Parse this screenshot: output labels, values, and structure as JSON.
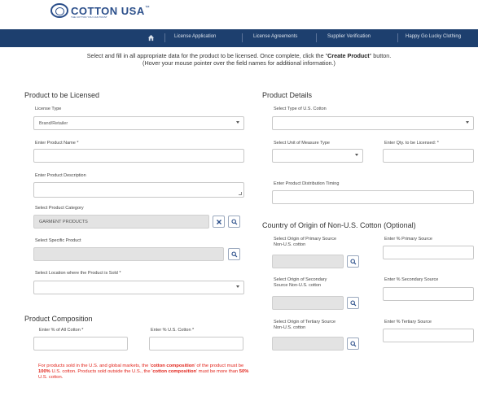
{
  "brand": {
    "logo_text": "COTTON USA",
    "tm": "™",
    "tagline": "THE COTTON YOU CAN TRUST"
  },
  "nav": {
    "items": [
      {
        "label": "License Application"
      },
      {
        "label": "License Agreements"
      },
      {
        "label": "Supplier Verification"
      },
      {
        "label": "Happy Go Lucky Clothing"
      }
    ]
  },
  "intro": {
    "line1_prefix": "Select and fill in all appropriate data for the product to be licensed.  Once complete, click the \"",
    "line1_bold": "Create Product",
    "line1_suffix": "\" button.",
    "line2": "(Hover your mouse pointer over the field names for additional information.)"
  },
  "left": {
    "title": "Product to be Licensed",
    "license_type": {
      "label": "License Type",
      "value": "Brand/Retailer"
    },
    "product_name": {
      "label": "Enter Product Name *",
      "value": ""
    },
    "product_description": {
      "label": "Enter Product Description",
      "value": ""
    },
    "product_category": {
      "label": "Select Product Category",
      "value": "GARMENT PRODUCTS"
    },
    "specific_product": {
      "label": "Select Specific Product",
      "value": ""
    },
    "location_sold": {
      "label": "Select Location where the Product is Sold *",
      "value": ""
    }
  },
  "composition": {
    "title": "Product Composition",
    "all_cotton": {
      "label": "Enter % of All Cotton *",
      "value": ""
    },
    "us_cotton": {
      "label": "Enter % U.S. Cotton *",
      "value": ""
    }
  },
  "warning": {
    "p1": "For products sold in the U.S. and global markets, the '",
    "b1": "cotton composition",
    "p2": "' of the product must be ",
    "b2": "100%",
    "p3": " U.S. cotton.  Products sold outside the U.S., the '",
    "b3": "cotton composition",
    "p4": "' must be more than ",
    "b4": "50%",
    "p5": " U.S. cotton."
  },
  "right": {
    "title": "Product Details",
    "type_us_cotton": {
      "label": "Select Type of U.S. Cotton",
      "value": ""
    },
    "unit_measure": {
      "label": "Select Unit of Measure Type",
      "value": ""
    },
    "qty_licensed": {
      "label": "Enter Qty. to be Licensed: *",
      "value": ""
    },
    "distribution_timing": {
      "label": "Enter Product Distribution Timing",
      "value": ""
    }
  },
  "origin": {
    "title": "Country of Origin of Non-U.S. Cotton (Optional)",
    "primary_origin": {
      "label_line1": "Select Origin of Primary Source",
      "label_line2": "Non-U.S. cotton",
      "value": ""
    },
    "primary_pct": {
      "label": "Enter % Primary Source",
      "value": ""
    },
    "secondary_origin": {
      "label_line1": "Select Origin of Secondary",
      "label_line2": "Source Non-U.S. cotton",
      "value": ""
    },
    "secondary_pct": {
      "label": "Enter % Secondary Source",
      "value": ""
    },
    "tertiary_origin": {
      "label_line1": "Select Origin of Tertiary Source",
      "label_line2": "Non-U.S. cotton",
      "value": ""
    },
    "tertiary_pct": {
      "label": "Enter % Tertiary Source",
      "value": ""
    }
  },
  "colors": {
    "navbar": "#1d3f6e",
    "brand": "#2a4e8a",
    "warning": "#e2231a"
  },
  "icons": [
    "home-icon",
    "search-icon",
    "clear-icon",
    "chevron-down-icon"
  ]
}
